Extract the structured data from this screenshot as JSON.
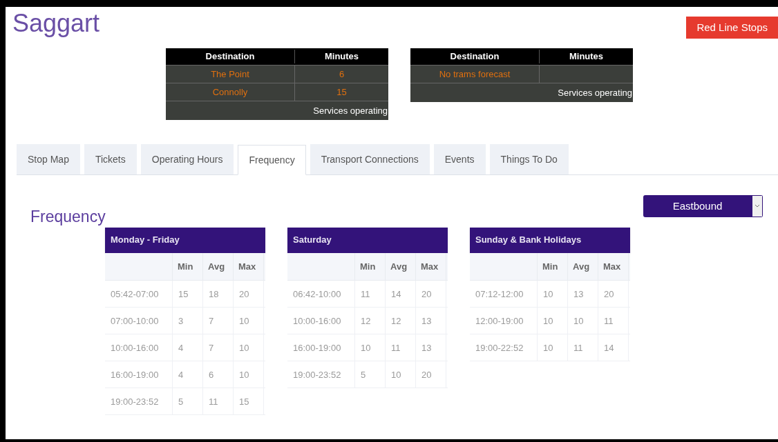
{
  "page_title": "Saggart",
  "line_button": "Red Line Stops",
  "forecasts": [
    {
      "columns": [
        "Destination",
        "Minutes"
      ],
      "rows": [
        {
          "destination": "The Point",
          "minutes": "6"
        },
        {
          "destination": "Connolly",
          "minutes": "15"
        }
      ],
      "status": "Services operating"
    },
    {
      "columns": [
        "Destination",
        "Minutes"
      ],
      "rows": [
        {
          "destination": "No trams forecast"
        }
      ],
      "status": "Services operating"
    }
  ],
  "tabs": [
    {
      "label": "Stop Map",
      "selected": false
    },
    {
      "label": "Tickets",
      "selected": false
    },
    {
      "label": "Operating Hours",
      "selected": false
    },
    {
      "label": "Frequency",
      "selected": true
    },
    {
      "label": "Transport Connections",
      "selected": false
    },
    {
      "label": "Events",
      "selected": false
    },
    {
      "label": "Things To Do",
      "selected": false
    }
  ],
  "section_title": "Frequency",
  "direction_select": "Eastbound",
  "timetables": [
    {
      "title": "Monday - Friday",
      "columns": [
        "Min",
        "Avg",
        "Max"
      ],
      "rows": [
        {
          "period": "05:42-07:00",
          "values": [
            "15",
            "18",
            "20"
          ]
        },
        {
          "period": "07:00-10:00",
          "values": [
            "3",
            "7",
            "10"
          ]
        },
        {
          "period": "10:00-16:00",
          "values": [
            "4",
            "7",
            "10"
          ]
        },
        {
          "period": "16:00-19:00",
          "values": [
            "4",
            "6",
            "10"
          ]
        },
        {
          "period": "19:00-23:52",
          "values": [
            "5",
            "11",
            "15"
          ]
        }
      ]
    },
    {
      "title": "Saturday",
      "columns": [
        "Min",
        "Avg",
        "Max"
      ],
      "rows": [
        {
          "period": "06:42-10:00",
          "values": [
            "11",
            "14",
            "20"
          ]
        },
        {
          "period": "10:00-16:00",
          "values": [
            "12",
            "12",
            "13"
          ]
        },
        {
          "period": "16:00-19:00",
          "values": [
            "10",
            "11",
            "13"
          ]
        },
        {
          "period": "19:00-23:52",
          "values": [
            "5",
            "10",
            "20"
          ]
        }
      ]
    },
    {
      "title": "Sunday & Bank Holidays",
      "columns": [
        "Min",
        "Avg",
        "Max"
      ],
      "rows": [
        {
          "period": "07:12-12:00",
          "values": [
            "10",
            "13",
            "20"
          ]
        },
        {
          "period": "12:00-19:00",
          "values": [
            "10",
            "10",
            "11"
          ]
        },
        {
          "period": "19:00-22:52",
          "values": [
            "10",
            "11",
            "14"
          ]
        }
      ]
    }
  ]
}
